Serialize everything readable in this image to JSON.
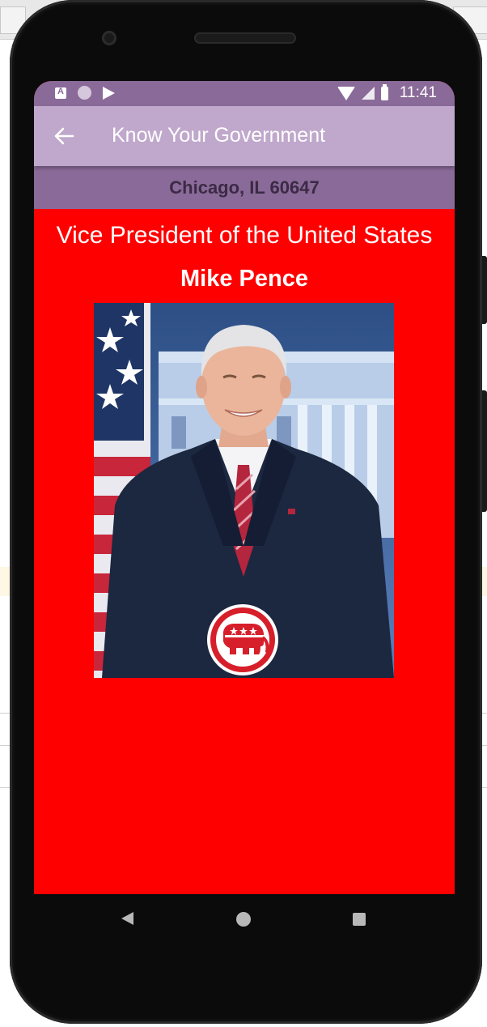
{
  "status_bar": {
    "time": "11:41",
    "icons": [
      "a-notification-icon",
      "circle-notification-icon",
      "play-store-icon",
      "wifi-icon",
      "signal-icon",
      "battery-icon"
    ]
  },
  "app_bar": {
    "title": "Know Your Government",
    "back_icon": "arrow-back-icon"
  },
  "location": {
    "text": "Chicago, IL 60647"
  },
  "official": {
    "office": "Vice President of the United States",
    "name": "Mike Pence",
    "party_logo": "republican-elephant-icon"
  },
  "nav_bar": {
    "icons": [
      "nav-back-icon",
      "nav-home-icon",
      "nav-recents-icon"
    ]
  },
  "colors": {
    "status_bar": "#8a6a98",
    "app_bar": "#c0a8cc",
    "location_bar": "#8a6a98",
    "content_background": "#ff0000",
    "location_text": "#3b2a45"
  }
}
